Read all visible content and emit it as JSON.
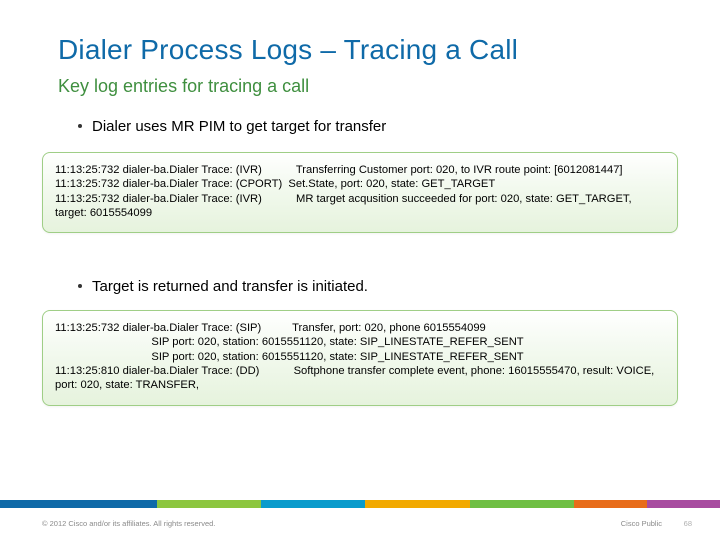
{
  "header": {
    "title": "Dialer Process Logs – Tracing a Call",
    "subtitle": "Key log entries for tracing a call"
  },
  "bullets": {
    "b1": "Dialer uses MR PIM to get target for transfer",
    "b2": "Target is returned and transfer is initiated."
  },
  "logs": {
    "box1": "11:13:25:732 dialer-ba.Dialer Trace: (IVR)           Transferring Customer port: 020, to IVR route point: [6012081447]\n11:13:25:732 dialer-ba.Dialer Trace: (CPORT)  Set.State, port: 020, state: GET_TARGET\n11:13:25:732 dialer-ba.Dialer Trace: (IVR)           MR target acqusition succeeded for port: 020, state: GET_TARGET, target: 6015554099",
    "box2": "11:13:25:732 dialer-ba.Dialer Trace: (SIP)          Transfer, port: 020, phone 6015554099\n                               SIP port: 020, station: 6015551120, state: SIP_LINESTATE_REFER_SENT\n                               SIP port: 020, station: 6015551120, state: SIP_LINESTATE_REFER_SENT\n11:13:25:810 dialer-ba.Dialer Trace: (DD)           Softphone transfer complete event, phone: 16015555470, result: VOICE, port: 020, state: TRANSFER,"
  },
  "footer": {
    "copyright": "© 2012 Cisco and/or its affiliates. All rights reserved.",
    "cisco_public": "Cisco Public",
    "page": "68"
  },
  "footer_colors": {
    "c1": "#0f6aa8",
    "c2": "#8cc63f",
    "c3": "#0a9bcc",
    "c4": "#f2a900",
    "c5": "#6fbf44",
    "c6": "#e86c1a",
    "c7": "#a84ca0"
  }
}
